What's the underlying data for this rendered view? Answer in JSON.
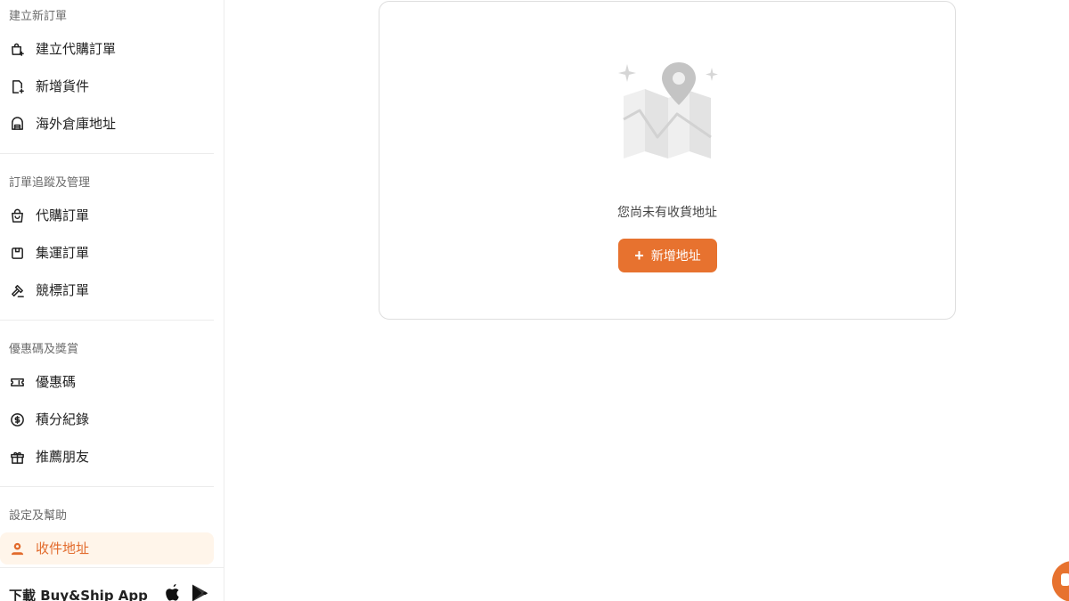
{
  "sidebar": {
    "sections": [
      {
        "title": "建立新訂單",
        "items": [
          {
            "label": "建立代購訂單",
            "icon": "shopping-bag-plus-icon"
          },
          {
            "label": "新增貨件",
            "icon": "file-plus-icon"
          },
          {
            "label": "海外倉庫地址",
            "icon": "warehouse-icon"
          }
        ]
      },
      {
        "title": "訂單追蹤及管理",
        "items": [
          {
            "label": "代購訂單",
            "icon": "shopping-bag-icon"
          },
          {
            "label": "集運訂單",
            "icon": "package-icon"
          },
          {
            "label": "競標訂單",
            "icon": "gavel-icon"
          }
        ]
      },
      {
        "title": "優惠碼及獎賞",
        "items": [
          {
            "label": "優惠碼",
            "icon": "ticket-icon"
          },
          {
            "label": "積分紀錄",
            "icon": "dollar-circle-icon"
          },
          {
            "label": "推薦朋友",
            "icon": "gift-icon"
          }
        ]
      },
      {
        "title": "設定及幫助",
        "items": [
          {
            "label": "收件地址",
            "icon": "location-user-icon",
            "active": true
          }
        ]
      }
    ],
    "download": {
      "label": "下載 Buy&Ship App",
      "icons": [
        "apple-icon",
        "google-play-icon"
      ]
    }
  },
  "main": {
    "empty_state": {
      "illustration": "map-pin-illustration",
      "message": "您尚未有收貨地址",
      "button_label": "新增地址",
      "button_icon": "plus-icon"
    }
  },
  "colors": {
    "accent": "#e7722f",
    "active_bg": "#fff5ea",
    "border": "#dedede"
  }
}
